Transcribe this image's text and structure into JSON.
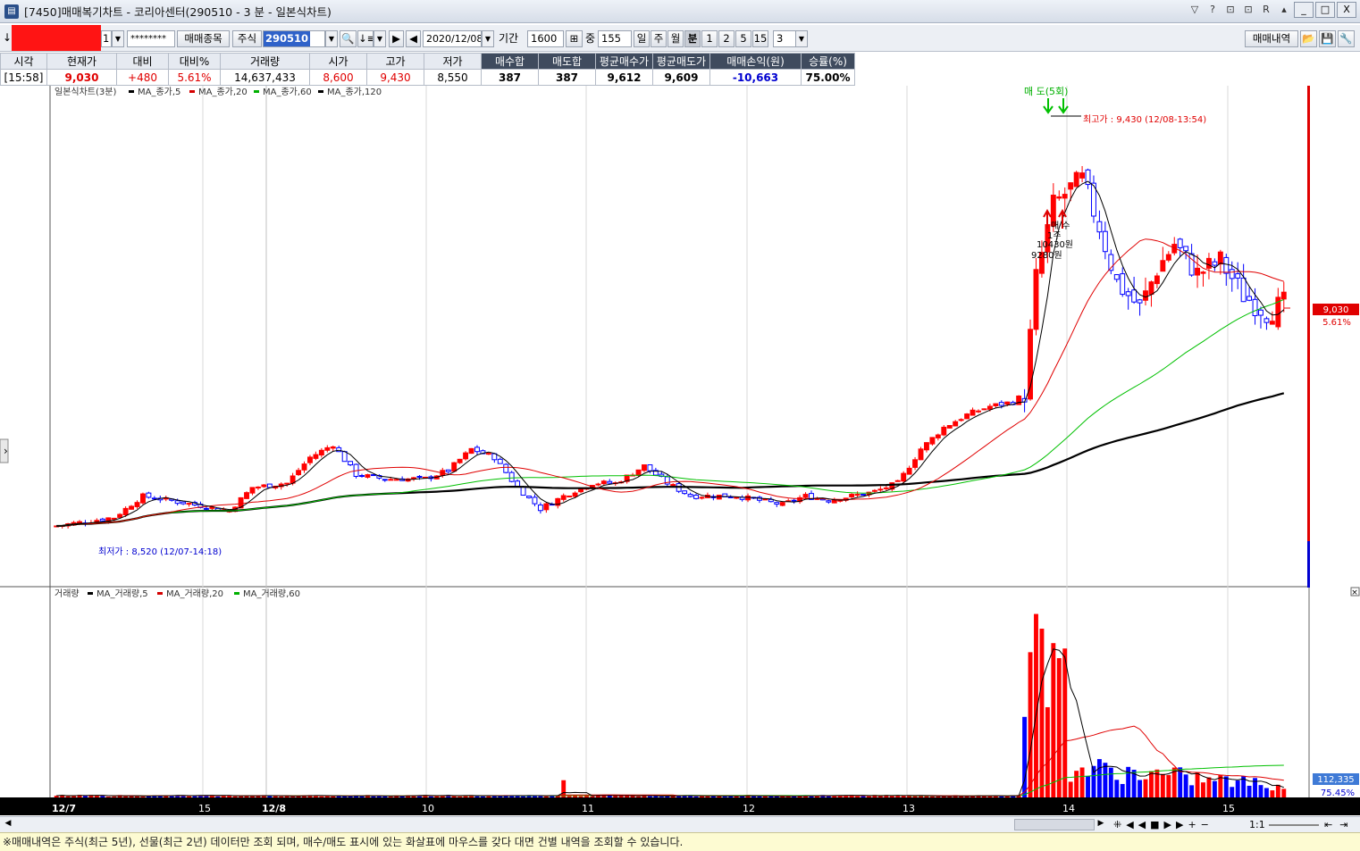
{
  "window": {
    "title": "[7450]매매복기차트 - 코리아센터(290510 - 3 분 - 일본식차트)",
    "controls": {
      "minimize": "_",
      "maximize": "□",
      "close": "X"
    },
    "tool_icons": [
      "▽",
      "?",
      "⊡",
      "⊡",
      "R",
      "▴"
    ]
  },
  "toolbar": {
    "account_suffix": "1",
    "password_mask": "********",
    "trade_stocks_label": "매매종목",
    "market_label": "주식",
    "stock_code": "290510",
    "date": "2020/12/08",
    "period_label": "기간",
    "period_value": "1600",
    "overlap_label": "중",
    "overlap_value": "155",
    "intervals": [
      "일",
      "주",
      "월",
      "분",
      "1",
      "2",
      "5",
      "15"
    ],
    "active_interval": "분",
    "minute_value": "3",
    "trade_history_label": "매매내역"
  },
  "quote": {
    "headers": [
      "시각",
      "현재가",
      "대비",
      "대비%",
      "거래량",
      "시가",
      "고가",
      "저가",
      "매수합",
      "매도합",
      "평균매수가",
      "평균매도가",
      "매매손익(원)",
      "승률(%)"
    ],
    "values": [
      "[15:58]",
      "9,030",
      "+480",
      "5.61%",
      "14,637,433",
      "8,600",
      "9,430",
      "8,550",
      "387",
      "387",
      "9,612",
      "9,609",
      "-10,663",
      "75.00%"
    ],
    "colors": {
      "up": "#e00000",
      "down": "#0000d0",
      "neutral": "#000000"
    }
  },
  "chart_data": [
    {
      "type": "candlestick",
      "title": "일본식차트(3분)",
      "legend": [
        "MA_종가,5",
        "MA_종가,20",
        "MA_종가,60",
        "MA_종가,120"
      ],
      "legend_colors": [
        "#000000",
        "#d40000",
        "#00b000",
        "#000000"
      ],
      "x_labels": [
        "12/7",
        "15",
        "12/8",
        "10",
        "11",
        "12",
        "13",
        "14",
        "15"
      ],
      "ylim": [
        8400,
        9570
      ],
      "current_price": "9,030",
      "current_change": "5.61%",
      "annotations": {
        "high": "최고가 : 9,430 (12/08-13:54)",
        "low": "최저가 : 8,520 (12/07-14:18)",
        "sell": "매 도(5회)",
        "buy_top": "매 수",
        "buy_qty": "1주",
        "buy_price1": "10430원",
        "buy_price2": "9280원"
      }
    },
    {
      "type": "bar",
      "title": "거래량",
      "legend": [
        "MA_거래량,5",
        "MA_거래량,20",
        "MA_거래량,60"
      ],
      "legend_colors": [
        "#000000",
        "#d40000",
        "#00b000"
      ],
      "ylim": [
        0,
        1000000
      ],
      "last_value": "112,335",
      "last_pct": "75.45%"
    }
  ],
  "scrollbar": {
    "zoom_label": "1:1",
    "nav": [
      "◀",
      "▶"
    ]
  },
  "status": "※매매내역은 주식(최근 5년), 선물(최근 2년) 데이터만 조회 되며, 매수/매도 표시에 있는 화살표에 마우스를 갖다 대면 건별 내역을 조회할 수 있습니다."
}
